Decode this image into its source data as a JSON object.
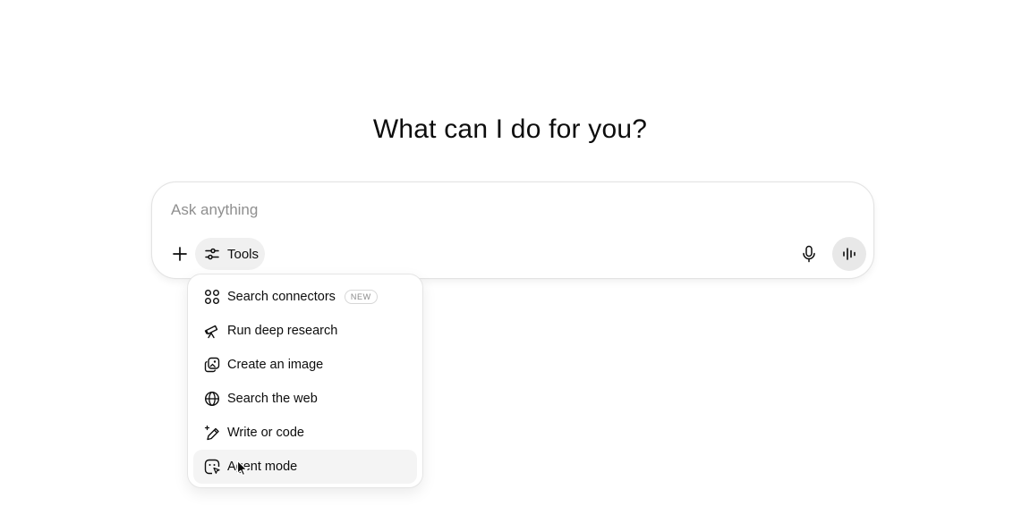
{
  "heading": "What can I do for you?",
  "composer": {
    "placeholder": "Ask anything",
    "value": "",
    "tools_label": "Tools"
  },
  "menu": {
    "items": [
      {
        "label": "Search connectors",
        "icon": "connectors-icon",
        "badge": "NEW"
      },
      {
        "label": "Run deep research",
        "icon": "telescope-icon"
      },
      {
        "label": "Create an image",
        "icon": "image-icon"
      },
      {
        "label": "Search the web",
        "icon": "globe-icon"
      },
      {
        "label": "Write or code",
        "icon": "pen-icon"
      },
      {
        "label": "Agent mode",
        "icon": "agent-icon",
        "hovered": true
      }
    ]
  },
  "colors": {
    "text": "#0d0d0d",
    "placeholder": "#8f8f8f",
    "tools_bg": "#f0f0f0",
    "voice_bg": "#e8e8e8",
    "menu_hover": "#f4f4f4"
  }
}
